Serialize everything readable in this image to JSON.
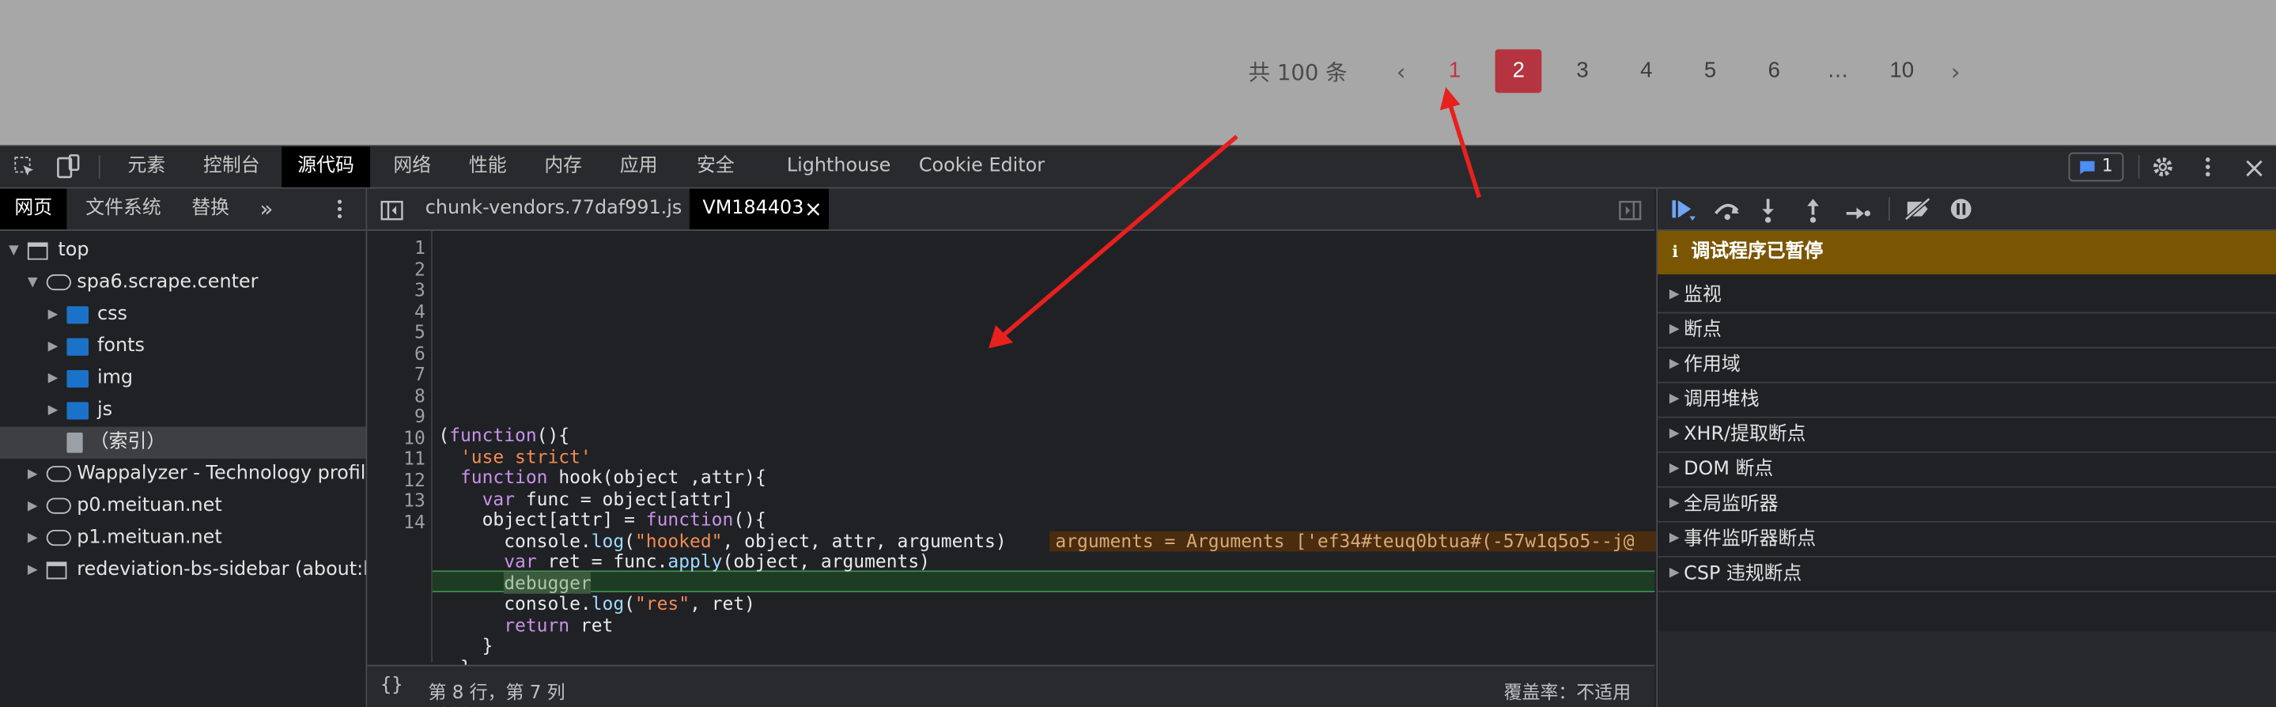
{
  "pagination": {
    "total": "共 100 条",
    "prev": "‹",
    "next": "›",
    "pages": [
      "1",
      "2",
      "3",
      "4",
      "5",
      "6",
      "…",
      "10"
    ],
    "current": "2"
  },
  "devtools": {
    "panel_tabs": [
      "元素",
      "控制台",
      "源代码",
      "网络",
      "性能",
      "内存",
      "应用",
      "安全",
      "Lighthouse",
      "Cookie Editor"
    ],
    "active_panel": "源代码",
    "issues_count": "1",
    "navigator": {
      "tabs": [
        "网页",
        "文件系统",
        "替换"
      ],
      "more": "»",
      "tree": [
        {
          "label": "top",
          "type": "frame",
          "depth": 0,
          "expanded": true
        },
        {
          "label": "spa6.scrape.center",
          "type": "domain",
          "depth": 1,
          "expanded": true
        },
        {
          "label": "css",
          "type": "folder",
          "depth": 2,
          "expanded": false
        },
        {
          "label": "fonts",
          "type": "folder",
          "depth": 2,
          "expanded": false
        },
        {
          "label": "img",
          "type": "folder",
          "depth": 2,
          "expanded": false
        },
        {
          "label": "js",
          "type": "folder",
          "depth": 2,
          "expanded": false
        },
        {
          "label": "（索引）",
          "type": "file",
          "depth": 3,
          "selected": true
        },
        {
          "label": "Wappalyzer - Technology profiler",
          "type": "domain",
          "depth": 1,
          "expanded": false
        },
        {
          "label": "p0.meituan.net",
          "type": "domain",
          "depth": 1,
          "expanded": false
        },
        {
          "label": "p1.meituan.net",
          "type": "domain",
          "depth": 1,
          "expanded": false
        },
        {
          "label": "redeviation-bs-sidebar (about:blank)",
          "type": "frame",
          "depth": 1,
          "expanded": false
        }
      ]
    },
    "editor": {
      "tabs": [
        "chunk-vendors.77daf991.js",
        "VM184403"
      ],
      "active_tab": "VM184403",
      "close": "×",
      "lines": [
        "1",
        "2",
        "3",
        "4",
        "5",
        "6",
        "7",
        "8",
        "9",
        "10",
        "11",
        "12",
        "13",
        "14"
      ],
      "inline_value": "arguments = Arguments ['ef34#teuq0btua#(-57w1q5o5--j@"
    },
    "status": {
      "format": "{}",
      "position": "第 8 行，第 7 列",
      "coverage": "覆盖率：不适用"
    },
    "debugger": {
      "paused": "调试程序已暂停",
      "sections": [
        "监视",
        "断点",
        "作用域",
        "调用堆栈",
        "XHR/提取断点",
        "DOM 断点",
        "全局监听器",
        "事件监听器断点",
        "CSP 违规断点"
      ]
    }
  },
  "colors": {
    "accent": "#b4353f",
    "paused_bg": "#7a5603",
    "arrow": "#e8201e"
  }
}
